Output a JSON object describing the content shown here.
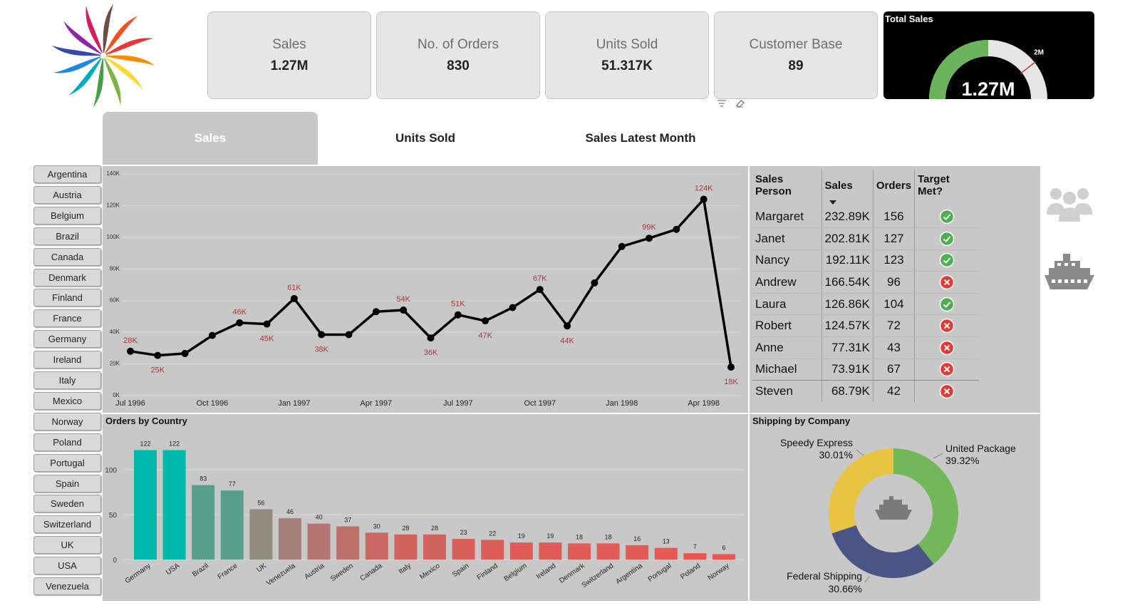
{
  "kpis": [
    {
      "label": "Sales",
      "value": "1.27M"
    },
    {
      "label": "No. of Orders",
      "value": "830"
    },
    {
      "label": "Units Sold",
      "value": "51.317K"
    },
    {
      "label": "Customer Base",
      "value": "89"
    }
  ],
  "gauge": {
    "title": "Total Sales",
    "value_label": "1.27M",
    "target_label": "2M",
    "value": 1.27,
    "target": 2.0,
    "max": 2.54,
    "fill_color": "#6bb35a",
    "track_color": "#e6e6e6",
    "target_color": "#c0392b"
  },
  "tabs": [
    {
      "label": "Sales",
      "active": true
    },
    {
      "label": "Units Sold",
      "active": false
    },
    {
      "label": "Sales Latest Month",
      "active": false
    }
  ],
  "countries": [
    "Argentina",
    "Austria",
    "Belgium",
    "Brazil",
    "Canada",
    "Denmark",
    "Finland",
    "France",
    "Germany",
    "Ireland",
    "Italy",
    "Mexico",
    "Norway",
    "Poland",
    "Portugal",
    "Spain",
    "Sweden",
    "Switzerland",
    "UK",
    "USA",
    "Venezuela"
  ],
  "sales_table": {
    "headers": [
      "Sales Person",
      "Sales",
      "Orders",
      "Target Met?"
    ],
    "rows": [
      {
        "name": "Margaret",
        "sales": "232.89K",
        "orders": "156",
        "met": true
      },
      {
        "name": "Janet",
        "sales": "202.81K",
        "orders": "127",
        "met": true
      },
      {
        "name": "Nancy",
        "sales": "192.11K",
        "orders": "123",
        "met": true
      },
      {
        "name": "Andrew",
        "sales": "166.54K",
        "orders": "96",
        "met": false
      },
      {
        "name": "Laura",
        "sales": "126.86K",
        "orders": "104",
        "met": true
      },
      {
        "name": "Robert",
        "sales": "124.57K",
        "orders": "72",
        "met": false
      },
      {
        "name": "Anne",
        "sales": "77.31K",
        "orders": "43",
        "met": false
      },
      {
        "name": "Michael",
        "sales": "73.91K",
        "orders": "67",
        "met": false
      },
      {
        "name": "Steven",
        "sales": "68.79K",
        "orders": "42",
        "met": false
      }
    ]
  },
  "side_icons": [
    "people-icon",
    "ship-icon"
  ],
  "colors": {
    "met": "#4caf50",
    "not_met": "#e53935",
    "line": "#000000",
    "data_label": "#a33a3a"
  },
  "chart_data": [
    {
      "type": "line",
      "title": "",
      "x": [
        "Jul 1996",
        "Aug 1996",
        "Sep 1996",
        "Oct 1996",
        "Nov 1996",
        "Dec 1996",
        "Jan 1997",
        "Feb 1997",
        "Mar 1997",
        "Apr 1997",
        "May 1997",
        "Jun 1997",
        "Jul 1997",
        "Aug 1997",
        "Sep 1997",
        "Oct 1997",
        "Nov 1997",
        "Dec 1997",
        "Jan 1998",
        "Feb 1998",
        "Mar 1998",
        "Apr 1998",
        "May 1998"
      ],
      "values": [
        28,
        25.4,
        26.6,
        38,
        46,
        45.2,
        61.3,
        38.5,
        38.5,
        53,
        54,
        36.4,
        51,
        47.2,
        55.6,
        67,
        44,
        71.2,
        94.2,
        99.4,
        105,
        124,
        18
      ],
      "value_labels": [
        "28K",
        "25K",
        "",
        "",
        "46K",
        "45K",
        "61K",
        "38K",
        "",
        "",
        "54K",
        "36K",
        "51K",
        "47K",
        "",
        "67K",
        "44K",
        "",
        "",
        "99K",
        "",
        "124K",
        "18K"
      ],
      "label_below": [
        false,
        true,
        false,
        false,
        false,
        true,
        false,
        true,
        false,
        false,
        false,
        true,
        false,
        true,
        false,
        false,
        true,
        false,
        false,
        false,
        false,
        false,
        true
      ],
      "x_ticks": [
        "Jul 1996",
        "Oct 1996",
        "Jan 1997",
        "Apr 1997",
        "Jul 1997",
        "Oct 1997",
        "Jan 1998",
        "Apr 1998"
      ],
      "x_tick_index": [
        0,
        3,
        6,
        9,
        12,
        15,
        18,
        21
      ],
      "y_ticks": [
        "0K",
        "20K",
        "40K",
        "60K",
        "80K",
        "100K",
        "120K",
        "140K"
      ],
      "ylim": [
        0,
        140
      ],
      "grid": true
    },
    {
      "type": "bar",
      "title": "Orders by Country",
      "categories": [
        "Germany",
        "USA",
        "Brazil",
        "France",
        "UK",
        "Venezuela",
        "Austria",
        "Sweden",
        "Canada",
        "Italy",
        "Mexico",
        "Spain",
        "Finland",
        "Belgium",
        "Ireland",
        "Denmark",
        "Switzerland",
        "Argentina",
        "Portugal",
        "Poland",
        "Norway"
      ],
      "values": [
        122,
        122,
        83,
        77,
        56,
        46,
        40,
        37,
        30,
        28,
        28,
        23,
        22,
        19,
        19,
        18,
        18,
        16,
        13,
        7,
        6
      ],
      "colors": [
        "#01b8aa",
        "#01b8aa",
        "#5a9e8c",
        "#5a9e8c",
        "#918a7f",
        "#a58079",
        "#b47670",
        "#bd706a",
        "#ca6963",
        "#d3635e",
        "#d3635e",
        "#db5f5a",
        "#dd5e59",
        "#e05c58",
        "#e05c58",
        "#e15b57",
        "#e15b57",
        "#e35a56",
        "#e65854",
        "#ec5450",
        "#ed5450"
      ],
      "y_ticks": [
        "0",
        "50",
        "100"
      ],
      "ylim": [
        0,
        130
      ],
      "grid": true
    },
    {
      "type": "pie",
      "title": "Shipping by Company",
      "slices": [
        {
          "name": "United Package",
          "value": 39.32,
          "label": "39.32%",
          "color": "#72b85a"
        },
        {
          "name": "Federal Shipping",
          "value": 30.66,
          "label": "30.66%",
          "color": "#4a5586"
        },
        {
          "name": "Speedy Express",
          "value": 30.01,
          "label": "30.01%",
          "color": "#e8c442"
        }
      ]
    }
  ]
}
